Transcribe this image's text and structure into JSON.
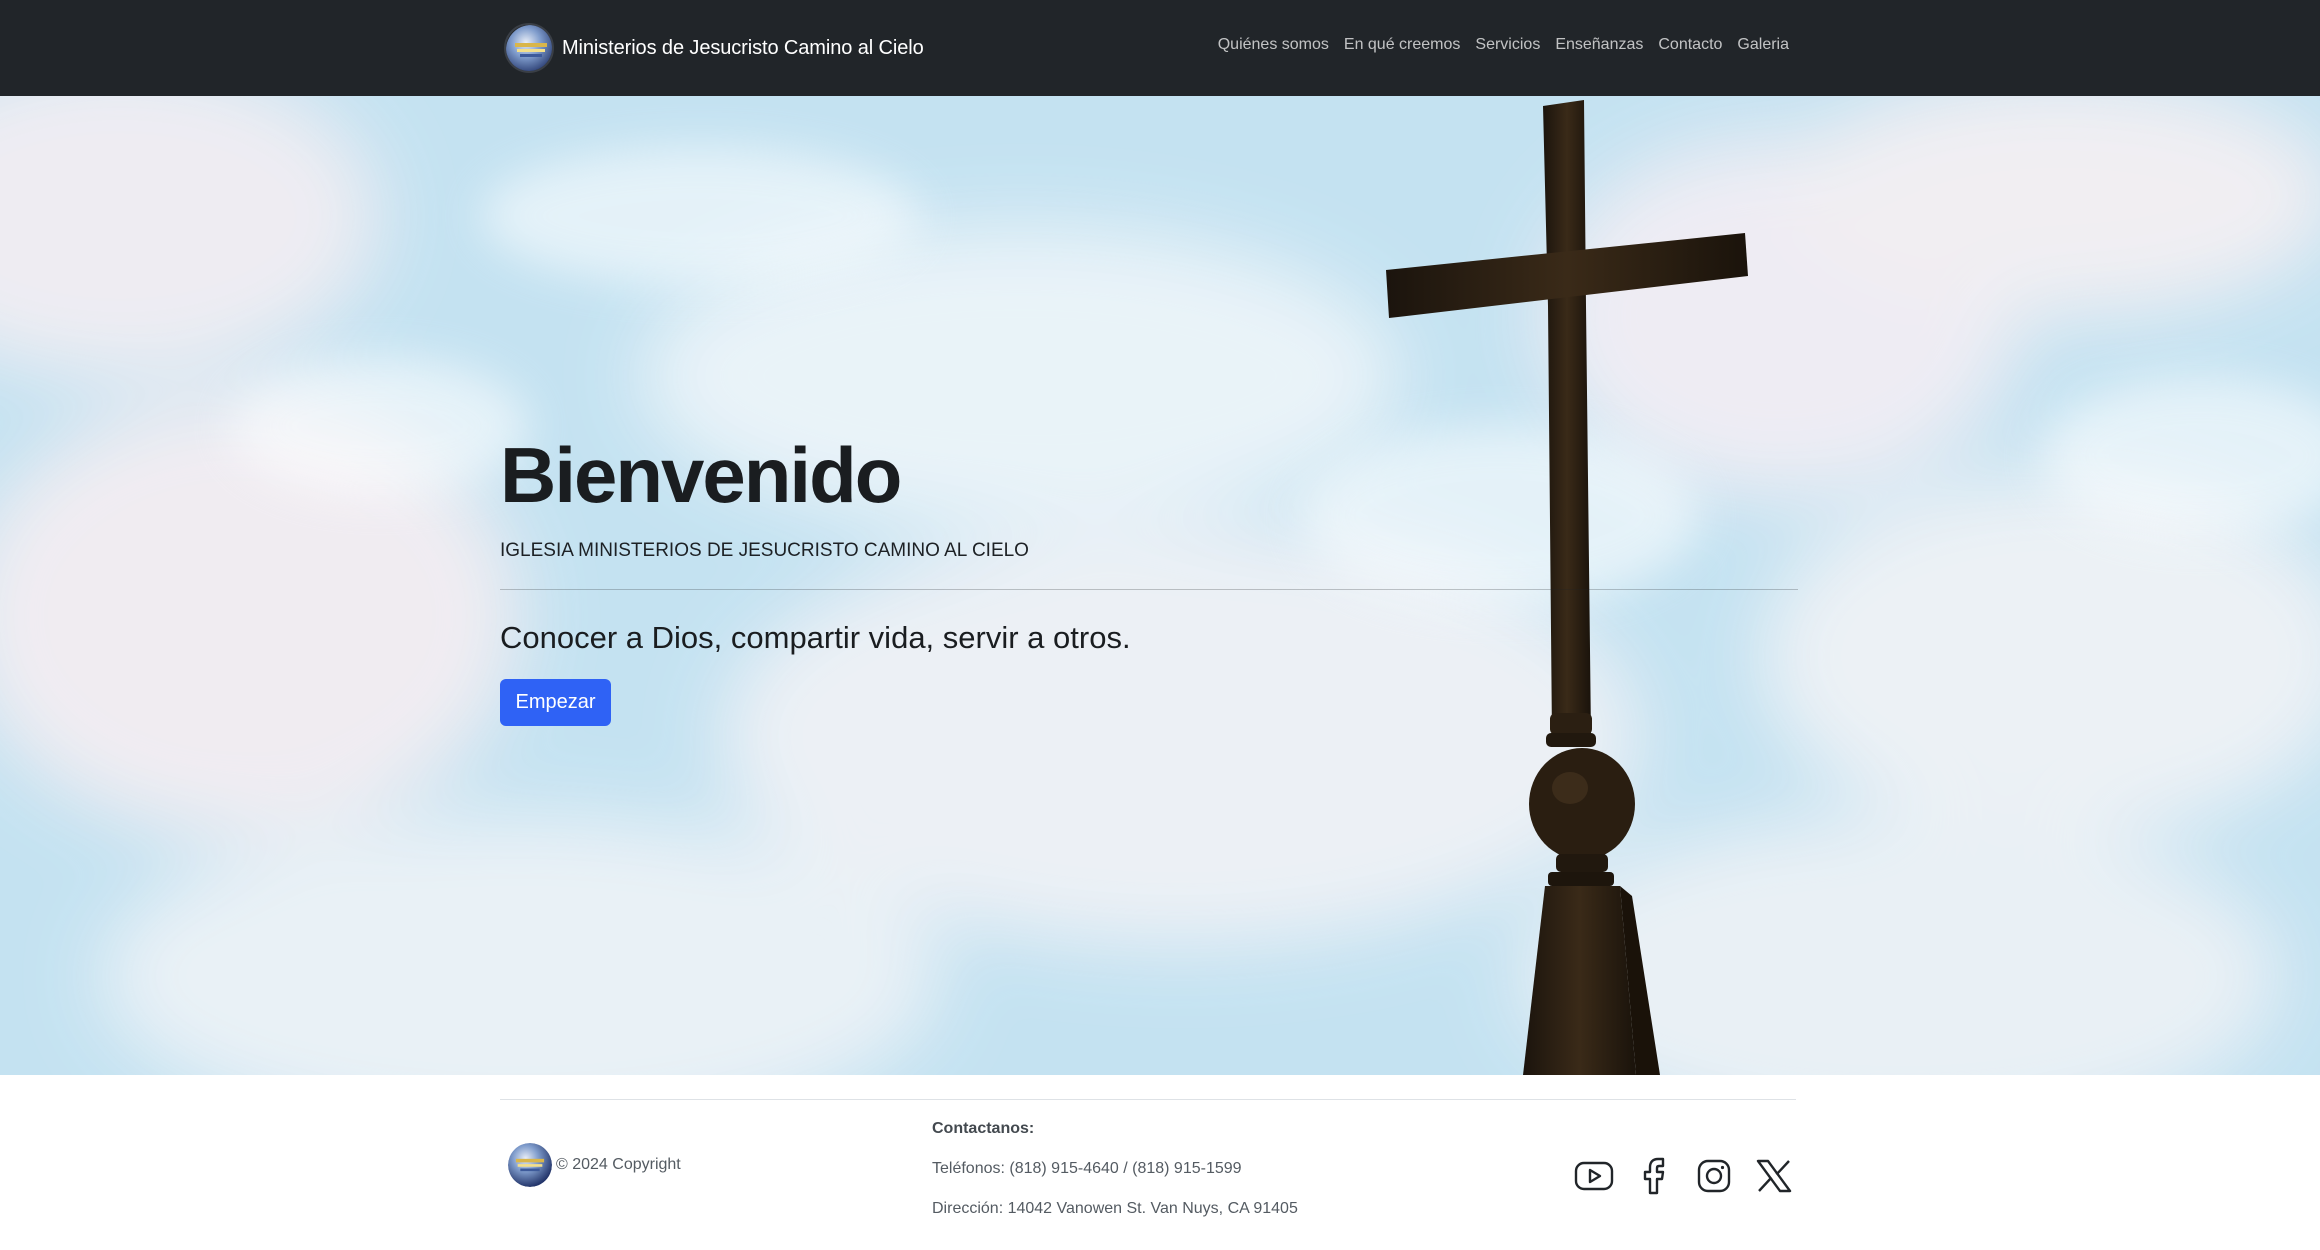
{
  "navbar": {
    "brand_name": "Ministerios de Jesucristo Camino al Cielo",
    "links": [
      {
        "label": "Quiénes somos"
      },
      {
        "label": "En qué creemos"
      },
      {
        "label": "Servicios"
      },
      {
        "label": "Enseñanzas"
      },
      {
        "label": "Contacto"
      },
      {
        "label": "Galeria"
      }
    ]
  },
  "hero": {
    "title": "Bienvenido",
    "subtitle": "IGLESIA MINISTERIOS DE JESUCRISTO CAMINO AL CIELO",
    "lead": "Conocer a Dios, compartir vida, servir a otros.",
    "button_label": "Empezar",
    "background_image": "cross-against-sky"
  },
  "footer": {
    "copyright": "© 2024 Copyright",
    "contact_heading": "Contactanos:",
    "phones": "Teléfonos: (818) 915-4640 / (818) 915-1599",
    "address": "Dirección: 14042 Vanowen St. Van Nuys, CA 91405",
    "socials": [
      {
        "icon": "youtube-icon"
      },
      {
        "icon": "facebook-icon"
      },
      {
        "icon": "instagram-icon"
      },
      {
        "icon": "x-twitter-icon"
      }
    ]
  },
  "colors": {
    "navbar_bg": "#212529",
    "primary_button": "#2f62f5",
    "sky": "#bfe0f0"
  }
}
